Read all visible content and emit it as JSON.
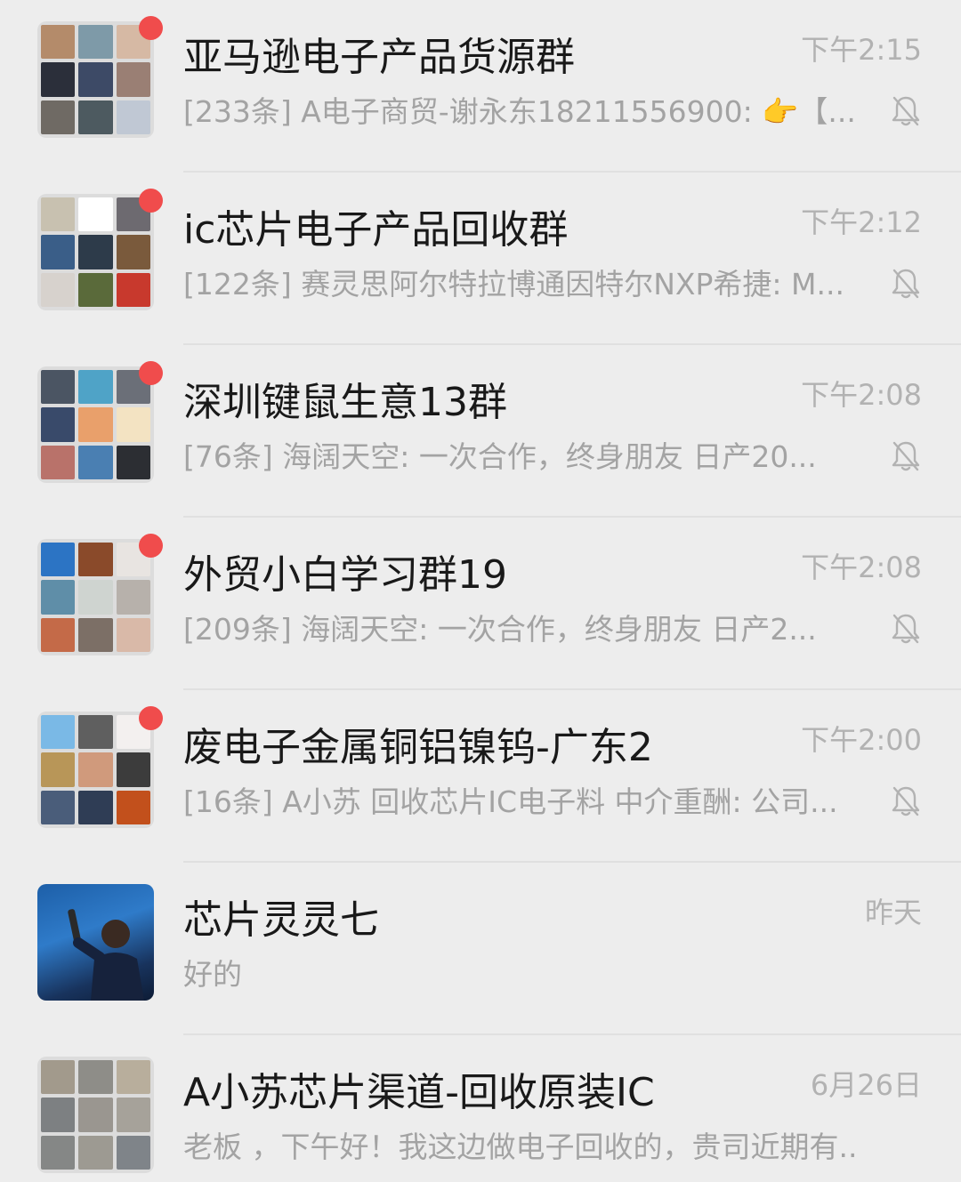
{
  "chats": [
    {
      "title": "亚马逊电子产品货源群",
      "time": "下午2:15",
      "preview": "[233条] A电子商贸-谢永东18211556900: 👉【...",
      "muted": true,
      "unread_dot": true,
      "avatar_colors": [
        "#b48b6a",
        "#7e9aa8",
        "#d6b9a4",
        "#2b2f3a",
        "#3d4a66",
        "#9a7f74",
        "#6f6a64",
        "#4d5a60",
        "#c0c8d4"
      ]
    },
    {
      "title": "ic芯片电子产品回收群",
      "time": "下午2:12",
      "preview": "[122条] 赛灵思阿尔特拉博通因特尔NXP希捷: M...",
      "muted": true,
      "unread_dot": true,
      "avatar_colors": [
        "#c8c1b0",
        "#ffffff",
        "#6d6a70",
        "#3a5e88",
        "#2d3b4a",
        "#7a5a3c",
        "#d7d2cd",
        "#5a6a3a",
        "#c8392d"
      ]
    },
    {
      "title": "深圳键鼠生意13群",
      "time": "下午2:08",
      "preview": "[76条] 海阔天空:   一次合作，终身朋友  日产20...",
      "muted": true,
      "unread_dot": true,
      "avatar_colors": [
        "#4b5563",
        "#4fa3c7",
        "#6b6f78",
        "#394a6a",
        "#e9a06b",
        "#f3e3c2",
        "#b9726a",
        "#4a7fb2",
        "#2c2e33"
      ]
    },
    {
      "title": "外贸小白学习群19",
      "time": "下午2:08",
      "preview": "[209条] 海阔天空:   一次合作，终身朋友  日产2...",
      "muted": true,
      "unread_dot": true,
      "avatar_colors": [
        "#2c74c4",
        "#8a4a2a",
        "#e8e4e1",
        "#5f8ea8",
        "#cfd4d0",
        "#b7b1ab",
        "#c46a48",
        "#7c6f66",
        "#d9b9a8"
      ]
    },
    {
      "title": "废电子金属铜铝镍钨-广东2",
      "time": "下午2:00",
      "preview": "[16条] A小苏 回收芯片IC电子料 中介重酬: 公司...",
      "muted": true,
      "unread_dot": true,
      "avatar_colors": [
        "#7ab9e6",
        "#5f5f5f",
        "#f3f0ef",
        "#b89658",
        "#d09a7c",
        "#3c3c3c",
        "#4a5d7a",
        "#2f3d55",
        "#c2501c"
      ]
    },
    {
      "title": "芯片灵灵七",
      "time": "昨天",
      "preview": "好的",
      "muted": false,
      "unread_dot": false,
      "avatar_colors": []
    },
    {
      "title": "A小苏芯片渠道-回收原装IC",
      "time": "6月26日",
      "preview": "老板 ，下午好！我这边做电子回收的，贵司近期有...",
      "muted": false,
      "unread_dot": false,
      "avatar_colors": [
        "#a29a8c",
        "#8e8d88",
        "#b8ae9c",
        "#7d8082",
        "#9a9690",
        "#a6a29a",
        "#858786",
        "#9d9a92",
        "#7f8489"
      ]
    }
  ],
  "colors": {
    "background": "#ededed",
    "unread_badge": "#f04c4c",
    "title_text": "#191919",
    "secondary_text": "#a3a3a3"
  },
  "icons": {
    "mute": "bell-off-icon"
  }
}
